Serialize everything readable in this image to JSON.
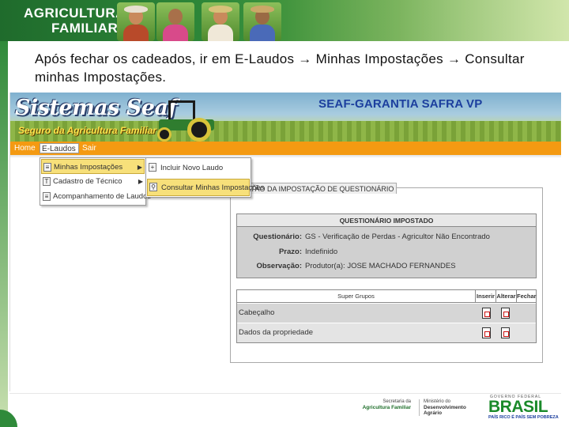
{
  "banner": {
    "title_line1": "AGRICULTURA",
    "title_line2": "FAMILIAR"
  },
  "caption": "Após fechar os cadeados, ir em E-Laudos → Minhas Impostações → Consultar minhas Impostações.",
  "app": {
    "logo_main": "Sistemas Seaf",
    "logo_sub": "Seguro da Agricultura Familiar",
    "title": "SEAF-GARANTIA SAFRA VP"
  },
  "menu": {
    "home": "Home",
    "elaudos": "E-Laudos",
    "sair": "Sair"
  },
  "elaudos_menu": [
    {
      "label": "Minhas Impostações",
      "icon": "document-icon",
      "selected": true,
      "has_submenu": true
    },
    {
      "label": "Cadastro de Técnico",
      "icon": "form-icon",
      "selected": false,
      "has_submenu": true
    },
    {
      "label": "Acompanhamento de Laudos",
      "icon": "list-icon",
      "selected": false,
      "has_submenu": false
    }
  ],
  "impostacoes_menu": [
    {
      "label": "Incluir Novo Laudo",
      "icon": "new-document-icon",
      "selected": false
    },
    {
      "label": "Consultar Minhas Impostações",
      "icon": "search-icon",
      "selected": true
    }
  ],
  "panel": {
    "tab_label": "GESTÃO DA IMPOSTAÇÃO DE QUESTIONÁRIO",
    "questionario": {
      "header": "QUESTIONÁRIO IMPOSTADO",
      "rows": [
        {
          "label": "Questionário:",
          "value": "GS - Verificação de Perdas - Agricultor Não Encontrado"
        },
        {
          "label": "Prazo:",
          "value": "Indefinido"
        },
        {
          "label": "Observação:",
          "value": "Produtor(a): JOSE MACHADO FERNANDES"
        }
      ]
    },
    "grupos": {
      "headers": [
        "Super Grupos",
        "Inserir",
        "Alterar",
        "Fechar"
      ],
      "rows": [
        {
          "label": "Cabeçalho"
        },
        {
          "label": "Dados da propriedade"
        }
      ]
    }
  },
  "footer": {
    "secretaria_line1": "Secretaria da",
    "secretaria_line2": "Agricultura Familiar",
    "ministerio_line1": "Ministério do",
    "ministerio_line2": "Desenvolvimento Agrário",
    "brasil_top": "GOVERNO FEDERAL",
    "brasil_word": "BRASIL",
    "brasil_tag": "PAÍS RICO É PAÍS SEM POBREZA"
  },
  "colors": {
    "menubar": "#f49a12",
    "highlight": "#f7e07a",
    "banner_green": "#2f8a3a",
    "app_title": "#1c3f9e"
  }
}
